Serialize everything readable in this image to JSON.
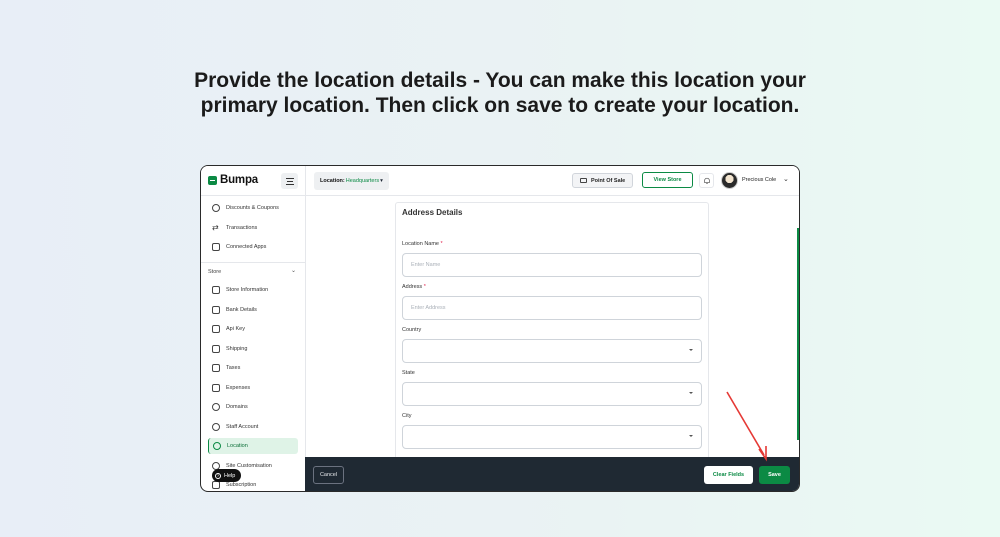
{
  "caption": {
    "line1": "Provide the location details - You can make this location your",
    "line2": "primary location. Then click on save to create your location."
  },
  "app": {
    "logo": "Bumpa",
    "location_label": "Location:",
    "location_value": "Headquarters",
    "location_caret": "▾",
    "point_of_sale": "Point Of Sale",
    "view_store": "View Store",
    "user_name": "Precious Cole",
    "user_chevron": "⌄",
    "icons": [
      "menu-icon",
      "pos-icon",
      "bell-icon",
      "chevron-down-icon",
      "help-icon"
    ]
  },
  "sidebar": {
    "items_top": [
      {
        "label": "Discounts & Coupons",
        "icon": "discount-icon"
      },
      {
        "label": "Transactions",
        "icon": "transfer-icon"
      },
      {
        "label": "Connected Apps",
        "icon": "apps-icon"
      }
    ],
    "section": "Store",
    "section_chevron": "⌄",
    "items": [
      {
        "label": "Store Information",
        "icon": "store-icon"
      },
      {
        "label": "Bank Details",
        "icon": "bank-icon"
      },
      {
        "label": "Api Key",
        "icon": "key-icon"
      },
      {
        "label": "Shipping",
        "icon": "truck-icon"
      },
      {
        "label": "Taxes",
        "icon": "tax-icon"
      },
      {
        "label": "Expenses",
        "icon": "expense-icon"
      },
      {
        "label": "Domains",
        "icon": "globe-icon"
      },
      {
        "label": "Staff Account",
        "icon": "user-icon"
      },
      {
        "label": "Location",
        "icon": "location-icon",
        "active": true
      },
      {
        "label": "Site Customisation",
        "icon": "palette-icon"
      },
      {
        "label": "Subscription",
        "icon": "layers-icon"
      }
    ],
    "help": "Help",
    "help_glyph": "?"
  },
  "form": {
    "title": "Address Details",
    "location_name": {
      "label": "Location Name",
      "required": "*",
      "placeholder": "Enter Name"
    },
    "address": {
      "label": "Address",
      "required": "*",
      "placeholder": "Enter Address"
    },
    "country": {
      "label": "Country"
    },
    "state": {
      "label": "State"
    },
    "city": {
      "label": "City"
    }
  },
  "footer": {
    "cancel": "Cancel",
    "clear_fields": "Clear Fields",
    "save": "Save"
  },
  "colors": {
    "brand_green": "#0b8a44",
    "footer_bg": "#1f2933",
    "annotation_arrow": "#e53935"
  }
}
